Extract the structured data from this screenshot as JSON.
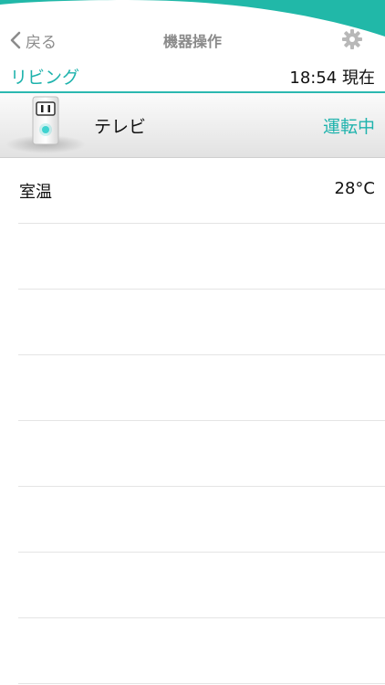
{
  "colors": {
    "accent": "#1fb3ad",
    "header_wave": "#21b8a8",
    "nav_text": "#8a8a8a"
  },
  "nav": {
    "back_label": "戻る",
    "back_icon": "chevron-left-icon",
    "title": "機器操作",
    "settings_icon": "gear-icon"
  },
  "room": {
    "name": "リビング",
    "time": "18:54 現在"
  },
  "device": {
    "name": "テレビ",
    "status": "運転中",
    "icon": "smart-plug-icon"
  },
  "rows": [
    {
      "label": "室温",
      "value": "28°C"
    },
    {
      "label": "",
      "value": ""
    },
    {
      "label": "",
      "value": ""
    },
    {
      "label": "",
      "value": ""
    },
    {
      "label": "",
      "value": ""
    },
    {
      "label": "",
      "value": ""
    },
    {
      "label": "",
      "value": ""
    },
    {
      "label": "",
      "value": ""
    }
  ]
}
